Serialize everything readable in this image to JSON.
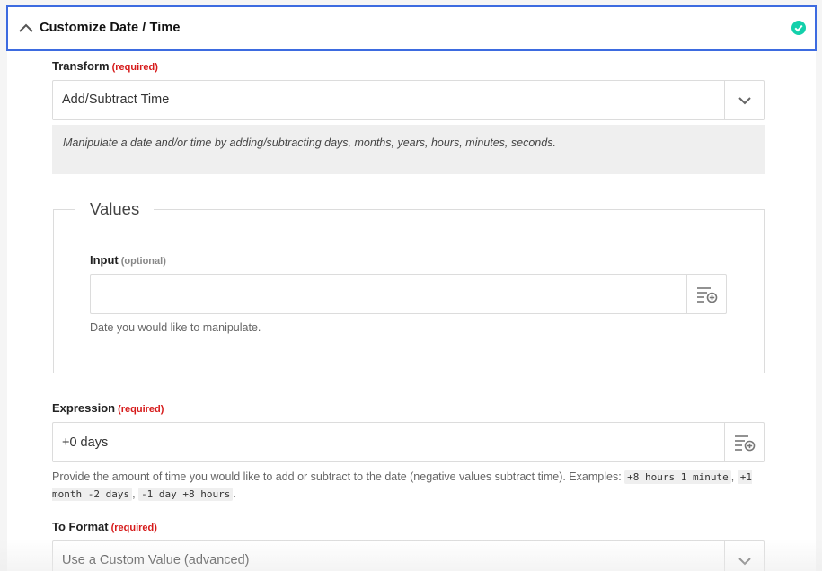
{
  "section": {
    "title": "Customize Date / Time",
    "check_color": "#13d0ab"
  },
  "transform": {
    "label": "Transform",
    "required": "(required)",
    "value": "Add/Subtract Time",
    "description": "Manipulate a date and/or time by adding/subtracting days, months, years, hours, minutes, seconds."
  },
  "values_group": {
    "legend": "Values",
    "input": {
      "label": "Input",
      "optional": "(optional)",
      "value": "",
      "help": "Date you would like to manipulate."
    }
  },
  "expression": {
    "label": "Expression",
    "required": "(required)",
    "value": "+0 days",
    "help_text": "Provide the amount of time you would like to add or subtract to the date (negative values subtract time). Examples:",
    "examples": [
      "+8 hours 1 minute",
      "+1 month -2 days",
      "-1 day +8 hours"
    ],
    "sep1": ",",
    "sep2": ",",
    "end": "."
  },
  "to_format": {
    "label": "To Format",
    "required": "(required)",
    "value": "Use a Custom Value (advanced)"
  }
}
